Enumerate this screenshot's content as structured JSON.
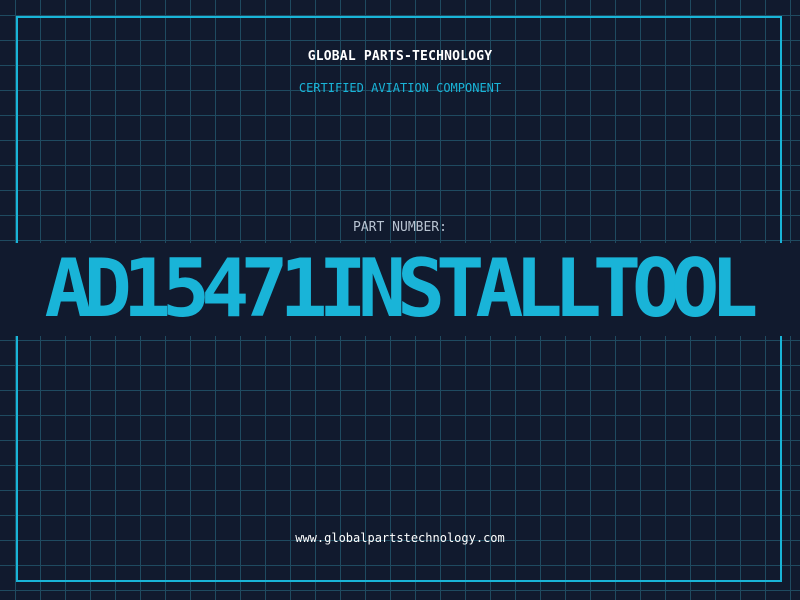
{
  "header": {
    "brand": "GLOBAL PARTS-TECHNOLOGY",
    "subtitle": "CERTIFIED AVIATION COMPONENT"
  },
  "part": {
    "label": "PART NUMBER:",
    "number": "AD15471INSTALLTOOL"
  },
  "footer": {
    "website": "www.globalpartstechnology.com"
  },
  "colors": {
    "background": "#111a2e",
    "grid": "#1f4a60",
    "accent": "#19b4d8",
    "text": "#ffffff",
    "label": "#b8c3d1"
  }
}
